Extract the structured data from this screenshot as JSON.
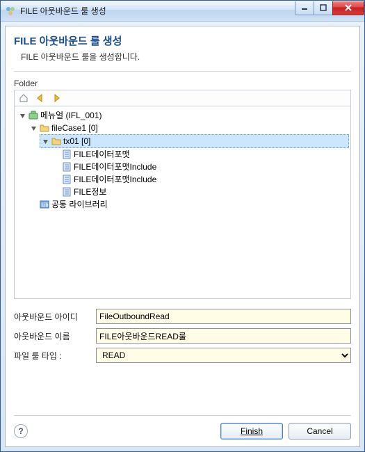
{
  "window": {
    "title": "FILE 아웃바운드 룰 생성"
  },
  "header": {
    "title": "FILE 아웃바운드 룰 생성",
    "subtitle": "FILE 아웃바운드 룰을 생성합니다."
  },
  "folder_label": "Folder",
  "tree": {
    "root": {
      "label": "메뉴얼  (IFL_001)",
      "children": {
        "filecase": {
          "label": "fileCase1 [0]",
          "children": {
            "tx01": {
              "label": "tx01  [0]",
              "children": {
                "fmt1": "FILE데이터포맷",
                "fmt2": "FILE데이터포맷Include",
                "fmt3": "FILE데이터포맷Include",
                "info": "FILE정보"
              }
            }
          }
        },
        "lib": {
          "label": "공통 라이브러리"
        }
      }
    }
  },
  "form": {
    "id_label": "아웃바운드 아이디",
    "id_value": "FileOutboundRead",
    "name_label": "아웃바운드 이름",
    "name_value": "FILE아웃바운드READ룰",
    "type_label": "파일 룰 타입 :",
    "type_value": "READ"
  },
  "buttons": {
    "finish": "Finish",
    "cancel": "Cancel"
  },
  "help_tooltip": "?"
}
